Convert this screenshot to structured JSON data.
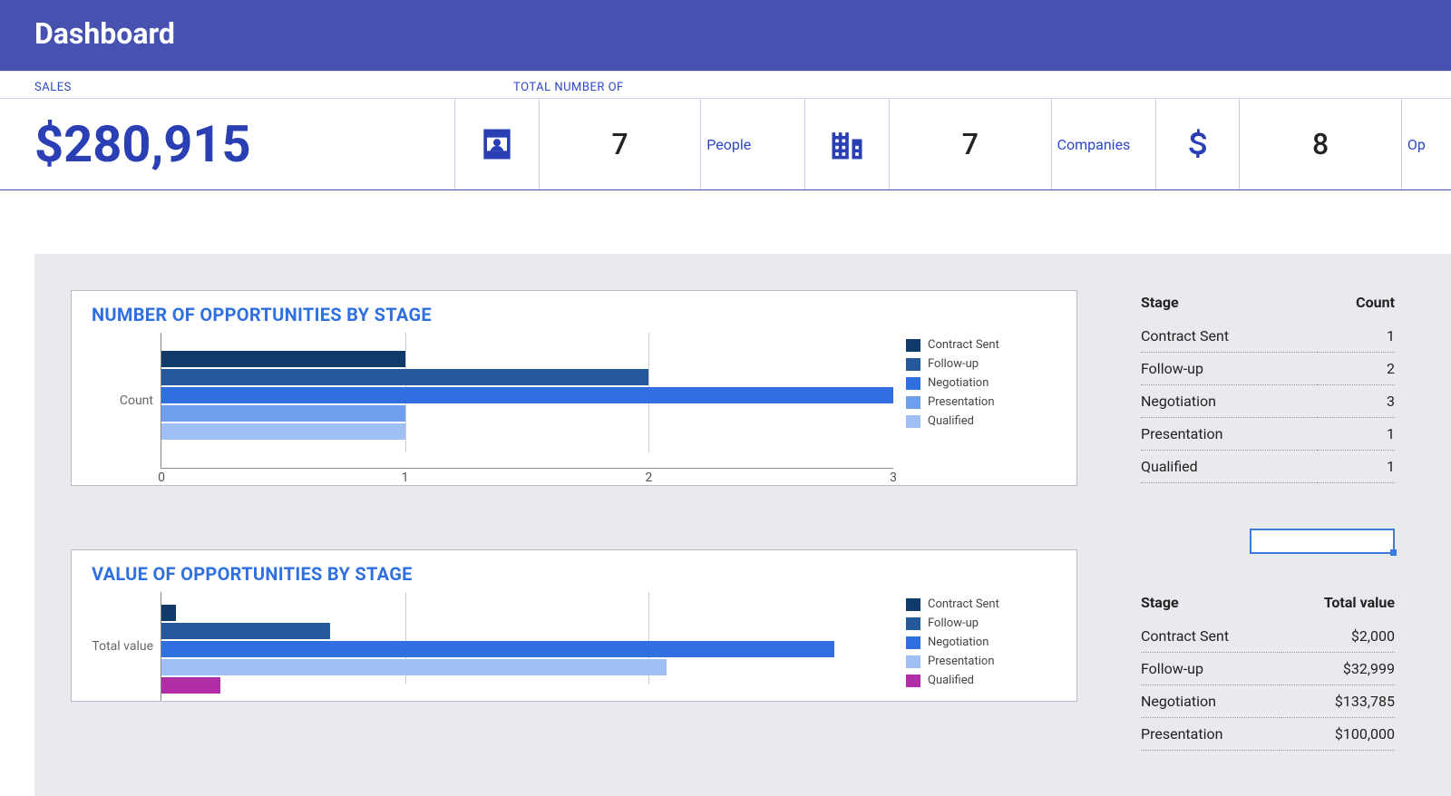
{
  "header": {
    "title": "Dashboard"
  },
  "kpi": {
    "sales_label": "SALES",
    "total_label": "TOTAL NUMBER OF",
    "sales_value": "$280,915",
    "people_count": "7",
    "people_label": "People",
    "companies_count": "7",
    "companies_label": "Companies",
    "opps_count": "8",
    "opps_label": "Op"
  },
  "chart1": {
    "title": "NUMBER OF OPPORTUNITIES BY STAGE",
    "ylabel": "Count",
    "legend": [
      "Contract Sent",
      "Follow-up",
      "Negotiation",
      "Presentation",
      "Qualified"
    ],
    "ticks": [
      "0",
      "1",
      "2",
      "3"
    ]
  },
  "chart2": {
    "title": "VALUE OF OPPORTUNITIES BY STAGE",
    "ylabel": "Total value",
    "legend": [
      "Contract Sent",
      "Follow-up",
      "Negotiation",
      "Presentation",
      "Qualified"
    ]
  },
  "table1": {
    "h1": "Stage",
    "h2": "Count",
    "rows": [
      {
        "s": "Contract Sent",
        "v": "1"
      },
      {
        "s": "Follow-up",
        "v": "2"
      },
      {
        "s": "Negotiation",
        "v": "3"
      },
      {
        "s": "Presentation",
        "v": "1"
      },
      {
        "s": "Qualified",
        "v": "1"
      }
    ]
  },
  "table2": {
    "h1": "Stage",
    "h2": "Total value",
    "rows": [
      {
        "s": "Contract Sent",
        "v": "$2,000"
      },
      {
        "s": "Follow-up",
        "v": "$32,999"
      },
      {
        "s": "Negotiation",
        "v": "$133,785"
      },
      {
        "s": "Presentation",
        "v": "$100,000"
      }
    ]
  },
  "chart_data": [
    {
      "type": "bar",
      "orientation": "horizontal",
      "title": "NUMBER OF OPPORTUNITIES BY STAGE",
      "ylabel": "Count",
      "xlim": [
        0,
        3
      ],
      "series": [
        {
          "name": "Contract Sent",
          "value": 1,
          "color": "#0f3a6a"
        },
        {
          "name": "Follow-up",
          "value": 2,
          "color": "#26599c"
        },
        {
          "name": "Negotiation",
          "value": 3,
          "color": "#2f6fe0"
        },
        {
          "name": "Presentation",
          "value": 1,
          "color": "#6ea0ef"
        },
        {
          "name": "Qualified",
          "value": 1,
          "color": "#9fc0f4"
        }
      ]
    },
    {
      "type": "bar",
      "orientation": "horizontal",
      "title": "VALUE OF OPPORTUNITIES BY STAGE",
      "ylabel": "Total value",
      "xlim": [
        0,
        150000
      ],
      "series": [
        {
          "name": "Contract Sent",
          "value": 2000,
          "color": "#0f3a6a"
        },
        {
          "name": "Follow-up",
          "value": 32999,
          "color": "#26599c"
        },
        {
          "name": "Negotiation",
          "value": 133785,
          "color": "#2f6fe0"
        },
        {
          "name": "Presentation",
          "value": 100000,
          "color": "#9fc0f4"
        },
        {
          "name": "Qualified",
          "value": 12000,
          "color": "#b22ea6"
        }
      ]
    }
  ]
}
